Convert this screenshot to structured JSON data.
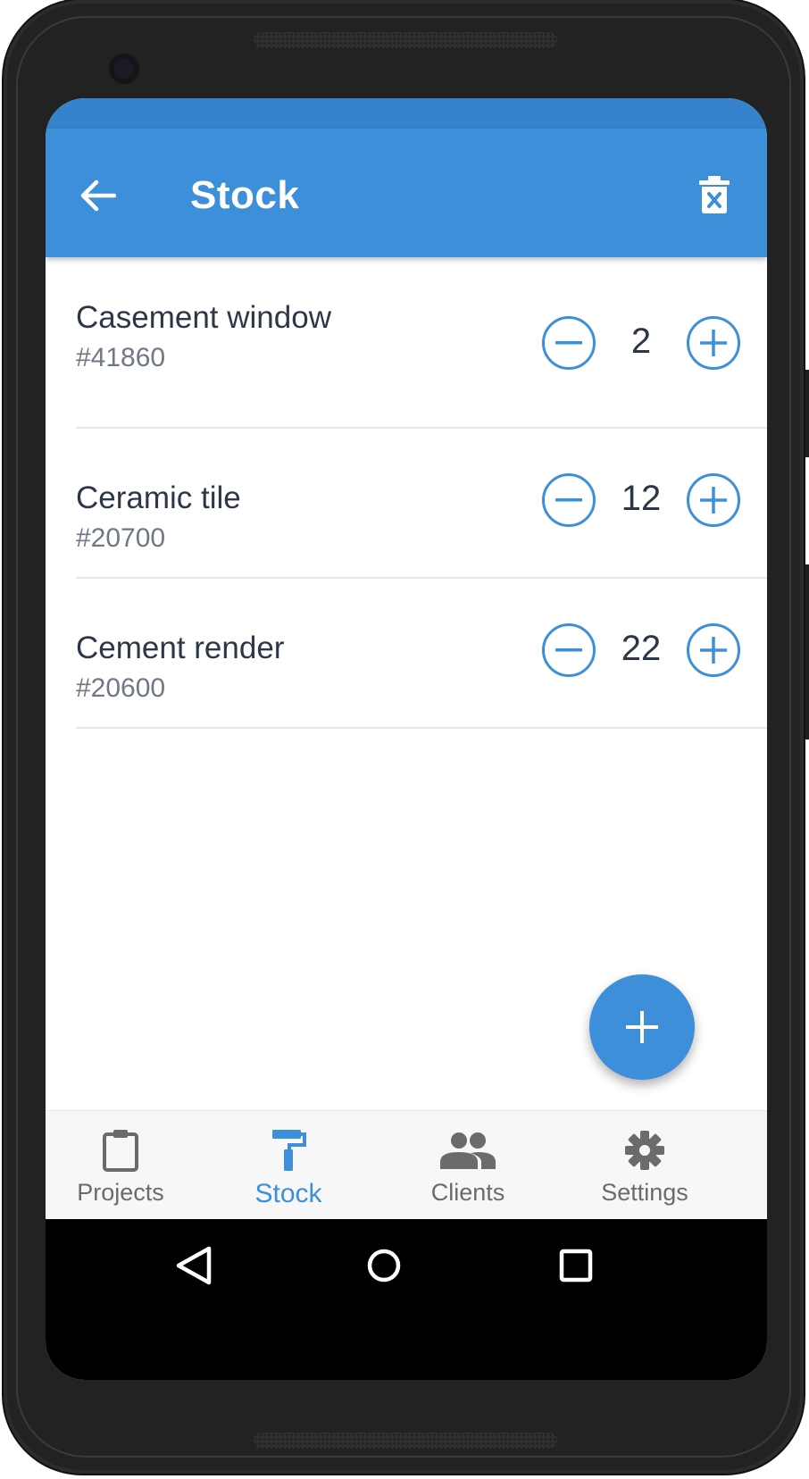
{
  "app_bar": {
    "title": "Stock",
    "back_icon": "arrow-left-icon",
    "action_icon": "delete-icon",
    "color": "#3e8fd9"
  },
  "stock_items": [
    {
      "name": "Casement window",
      "code": "#41860",
      "quantity": "2"
    },
    {
      "name": "Ceramic tile",
      "code": "#20700",
      "quantity": "12"
    },
    {
      "name": "Cement render",
      "code": "#20600",
      "quantity": "22"
    }
  ],
  "fab": {
    "icon": "plus-icon"
  },
  "bottom_nav": {
    "items": [
      {
        "label": "Projects",
        "icon": "clipboard-icon",
        "active": false
      },
      {
        "label": "Stock",
        "icon": "paint-roller-icon",
        "active": true
      },
      {
        "label": "Clients",
        "icon": "people-icon",
        "active": false
      },
      {
        "label": "Settings",
        "icon": "gear-icon",
        "active": false
      }
    ],
    "active_color": "#3e8fd9",
    "inactive_color": "#6b6b6b"
  },
  "system_nav": {
    "icons": [
      "back-triangle-icon",
      "home-circle-icon",
      "recents-square-icon"
    ]
  }
}
